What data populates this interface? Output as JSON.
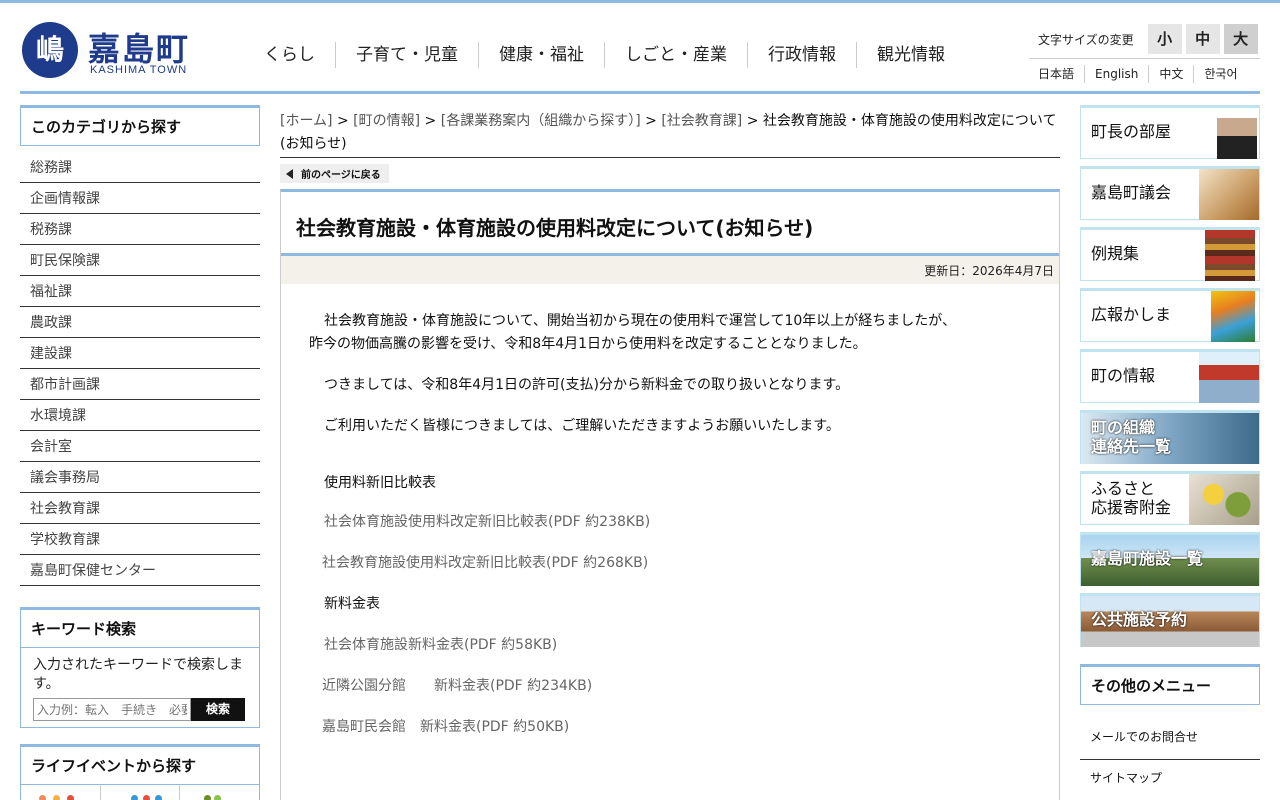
{
  "header": {
    "logo_mark": "嶋",
    "logo_title": "嘉島町",
    "logo_sub": "KASHIMA TOWN",
    "nav": [
      "くらし",
      "子育て・児童",
      "健康・福祉",
      "しごと・産業",
      "行政情報",
      "観光情報"
    ],
    "font_size_label": "文字サイズの変更",
    "font_sizes": [
      "小",
      "中",
      "大"
    ],
    "languages": [
      "日本語",
      "English",
      "中文",
      "한국어"
    ]
  },
  "sidebar": {
    "category_title": "このカテゴリから探す",
    "categories": [
      "総務課",
      "企画情報課",
      "税務課",
      "町民保険課",
      "福祉課",
      "農政課",
      "建設課",
      "都市計画課",
      "水環境課",
      "会計室",
      "議会事務局",
      "社会教育課",
      "学校教育課",
      "嘉島町保健センター"
    ],
    "keyword_title": "キーワード検索",
    "keyword_desc": "入力されたキーワードで検索します。",
    "keyword_placeholder": "入力例：転入　手続き　必要書類",
    "keyword_button": "検索",
    "life_title": "ライフイベントから探す"
  },
  "main": {
    "breadcrumb": [
      "[ホーム]",
      "[町の情報]",
      "[各課業務案内（組織から探す）]",
      "[社会教育課]"
    ],
    "breadcrumb_sep": " > ",
    "breadcrumb_current": "社会教育施設・体育施設の使用料改定について(お知らせ)",
    "back_label": "前のページに戻る",
    "title": "社会教育施設・体育施設の使用料改定について(お知らせ)",
    "updated": "更新日：2026年4月7日",
    "para1_line1": "社会教育施設・体育施設について、開始当初から現在の使用料で運営して10年以上が経ちましたが、",
    "para1_line2": "昨今の物価高騰の影響を受け、令和8年4月1日から使用料を改定することとなりました。",
    "para2": "つきましては、令和8年4月1日の許可(支払)分から新料金での取り扱いとなります。",
    "para3": "ご利用いただく皆様につきましては、ご理解いただきますようお願いいたします。",
    "section1": "使用料新旧比較表",
    "file1": "社会体育施設使用料改定新旧比較表(PDF 約238KB)",
    "file2": "社会教育施設使用料改定新旧比較表(PDF 約268KB)",
    "section2": "新料金表",
    "file3": "社会体育施設新料金表(PDF 約58KB)",
    "file4": "近隣公園分館　　新料金表(PDF 約234KB)",
    "file5": "嘉島町民会館　新料金表(PDF 約50KB)"
  },
  "right": {
    "banners": [
      {
        "line1": "町長の部屋",
        "line2": ""
      },
      {
        "line1": "嘉島町議会",
        "line2": ""
      },
      {
        "line1": "例規集",
        "line2": ""
      },
      {
        "line1": "広報かしま",
        "line2": ""
      },
      {
        "line1": "町の情報",
        "line2": ""
      },
      {
        "line1": "町の組織",
        "line2": "連絡先一覧"
      },
      {
        "line1": "ふるさと",
        "line2": "応援寄附金"
      },
      {
        "line1": "嘉島町施設一覧",
        "line2": ""
      },
      {
        "line1": "公共施設予約",
        "line2": ""
      }
    ],
    "other_title": "その他のメニュー",
    "other_items": [
      "メールでのお問合せ",
      "サイトマップ"
    ]
  },
  "colors": {
    "accent_blue": "#8eb9e0",
    "logo_blue": "#1f3b8c",
    "banner_border": "#bfe3ef",
    "updated_bg": "#f4f0ea"
  }
}
